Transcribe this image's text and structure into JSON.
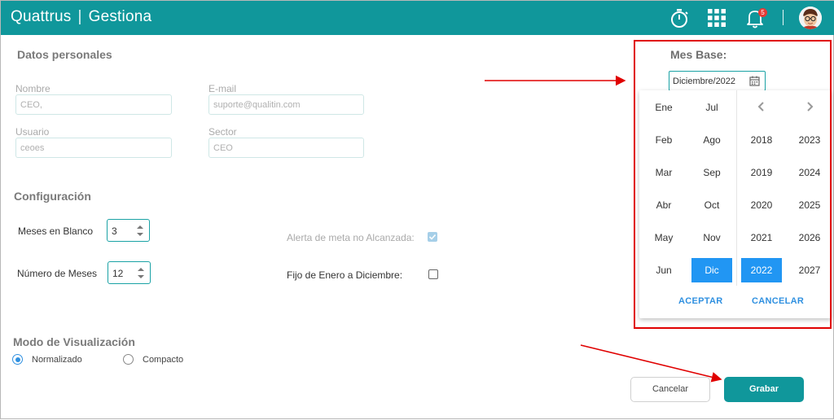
{
  "header": {
    "brand_name": "Quattrus",
    "brand_separator": "|",
    "brand_product": "Gestiona",
    "notifications_count": "5",
    "icons": [
      "stopwatch-icon",
      "apps-grid-icon",
      "bell-icon",
      "avatar"
    ]
  },
  "personal": {
    "title": "Datos personales",
    "nombre_label": "Nombre",
    "nombre_value": "CEO,",
    "email_label": "E-mail",
    "email_value": "suporte@qualitin.com",
    "usuario_label": "Usuario",
    "usuario_value": "ceoes",
    "sector_label": "Sector",
    "sector_value": "CEO"
  },
  "config": {
    "title": "Configuración",
    "meses_blanco_label": "Meses en Blanco",
    "meses_blanco_value": "3",
    "numero_meses_label": "Número de Meses",
    "numero_meses_value": "12",
    "alerta_label": "Alerta de meta no Alcanzada:",
    "alerta_checked": true,
    "fijo_label": "Fijo de Enero a Diciembre:",
    "fijo_checked": false
  },
  "view": {
    "title": "Modo de Visualización",
    "option_normal": "Normalizado",
    "option_compact": "Compacto",
    "selected": "Normalizado"
  },
  "actions": {
    "cancel": "Cancelar",
    "save": "Grabar"
  },
  "mes_base": {
    "label": "Mes Base:",
    "value": "Diciembre/2022",
    "picker": {
      "months_col1": [
        "Ene",
        "Feb",
        "Mar",
        "Abr",
        "May",
        "Jun"
      ],
      "months_col2": [
        "Jul",
        "Ago",
        "Sep",
        "Oct",
        "Nov",
        "Dic"
      ],
      "years_col1": [
        "2018",
        "2019",
        "2020",
        "2021",
        "2022"
      ],
      "years_col2": [
        "2023",
        "2024",
        "2025",
        "2026",
        "2027"
      ],
      "selected_month": "Dic",
      "selected_year": "2022",
      "accept": "ACEPTAR",
      "cancel": "CANCELAR"
    }
  },
  "colors": {
    "brand_teal": "#10979b",
    "selection_blue": "#2196f3",
    "highlight_red": "#e00000"
  }
}
